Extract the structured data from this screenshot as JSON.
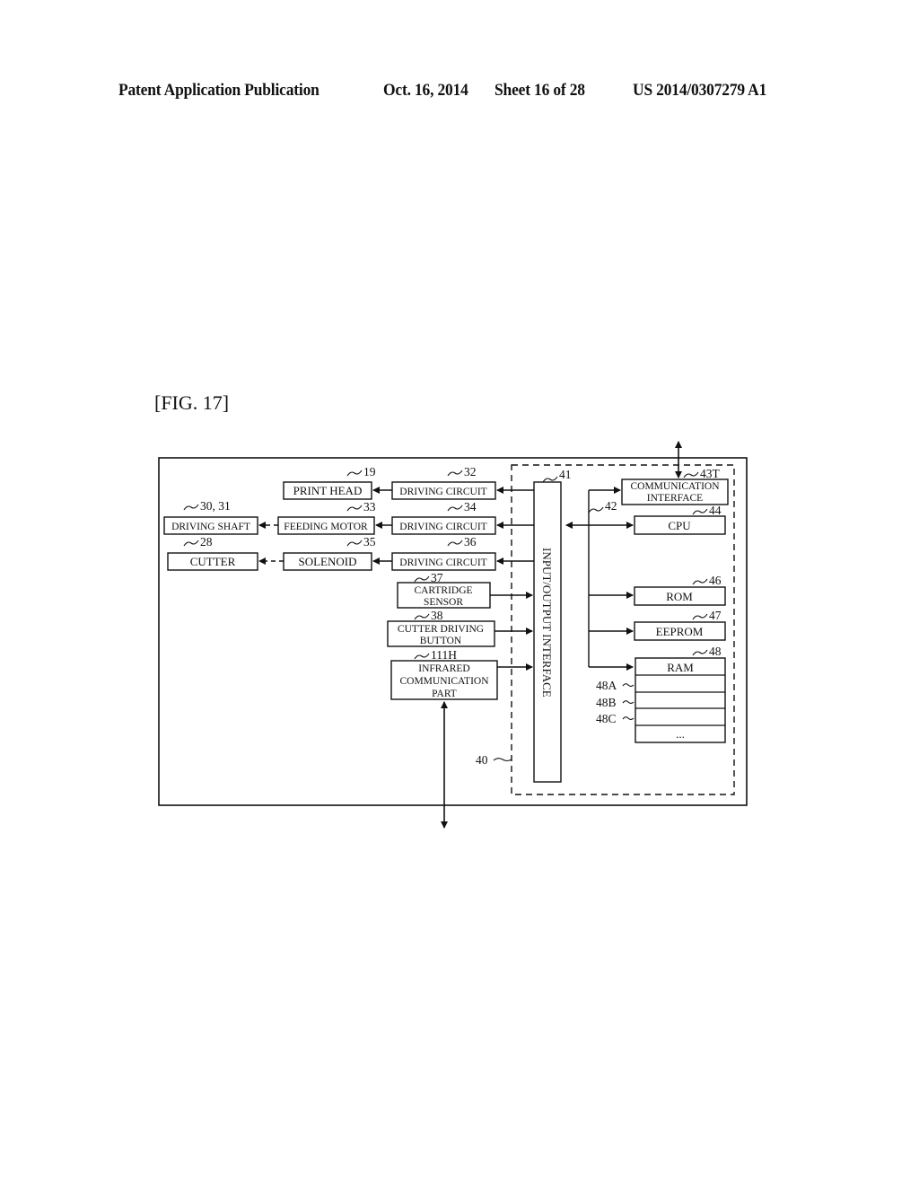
{
  "header": {
    "publication": "Patent Application Publication",
    "date": "Oct. 16, 2014",
    "sheet": "Sheet 16 of 28",
    "number": "US 2014/0307279 A1"
  },
  "figure": {
    "label": "[FIG. 17]"
  },
  "blocks": {
    "print_head": {
      "label": "PRINT HEAD",
      "ref": "19"
    },
    "driving_circuit_32": {
      "label": "DRIVING CIRCUIT",
      "ref": "32"
    },
    "driving_shaft": {
      "label": "DRIVING SHAFT",
      "ref": "30, 31"
    },
    "feeding_motor": {
      "label": "FEEDING MOTOR",
      "ref": "33"
    },
    "driving_circuit_34": {
      "label": "DRIVING CIRCUIT",
      "ref": "34"
    },
    "cutter": {
      "label": "CUTTER",
      "ref": "28"
    },
    "solenoid": {
      "label": "SOLENOID",
      "ref": "35"
    },
    "driving_circuit_36": {
      "label": "DRIVING CIRCUIT",
      "ref": "36"
    },
    "cartridge_sensor": {
      "line1": "CARTRIDGE",
      "line2": "SENSOR",
      "ref": "37"
    },
    "cutter_button": {
      "line1": "CUTTER DRIVING",
      "line2": "BUTTON",
      "ref": "38"
    },
    "infrared": {
      "line1": "INFRARED",
      "line2": "COMMUNICATION",
      "line3": "PART",
      "ref": "111H"
    },
    "io_interface": {
      "label": "INPUT/OUTPUT INTERFACE",
      "ref": "41"
    },
    "bus": {
      "ref": "42"
    },
    "comm_interface": {
      "line1": "COMMUNICATION",
      "line2": "INTERFACE",
      "ref": "43T"
    },
    "cpu": {
      "label": "CPU",
      "ref": "44"
    },
    "rom": {
      "label": "ROM",
      "ref": "46"
    },
    "eeprom": {
      "label": "EEPROM",
      "ref": "47"
    },
    "ram": {
      "label": "RAM",
      "ref": "48",
      "areas": [
        "48A",
        "48B",
        "48C"
      ],
      "more": "..."
    },
    "control_unit": {
      "ref": "40"
    }
  }
}
